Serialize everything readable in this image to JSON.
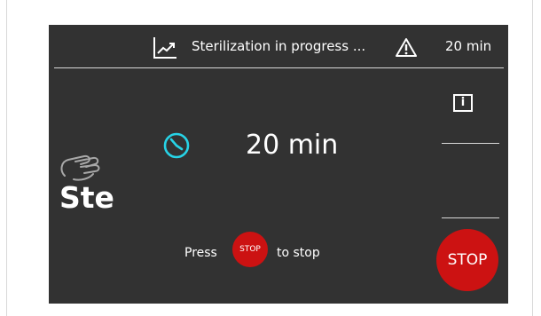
{
  "header": {
    "status_text": "Sterilization in progress ...",
    "remaining_time": "20 min",
    "chart_icon": "trend-chart-icon",
    "warning_icon": "warning-triangle-icon"
  },
  "side_panel": {
    "info_label": "i"
  },
  "main": {
    "timer_icon": "clock-icon",
    "timer_value": "20  min",
    "partial_label": "Ste",
    "hand_icon": "hand-gesture-icon"
  },
  "footer": {
    "press_label": "Press",
    "mini_stop_label": "STOP",
    "to_stop_label": "to stop"
  },
  "stop_button": {
    "label": "STOP"
  },
  "colors": {
    "screen_bg": "#323232",
    "text": "#ffffff",
    "stop_red": "#cc1212",
    "clock_cyan": "#27d3e6"
  }
}
